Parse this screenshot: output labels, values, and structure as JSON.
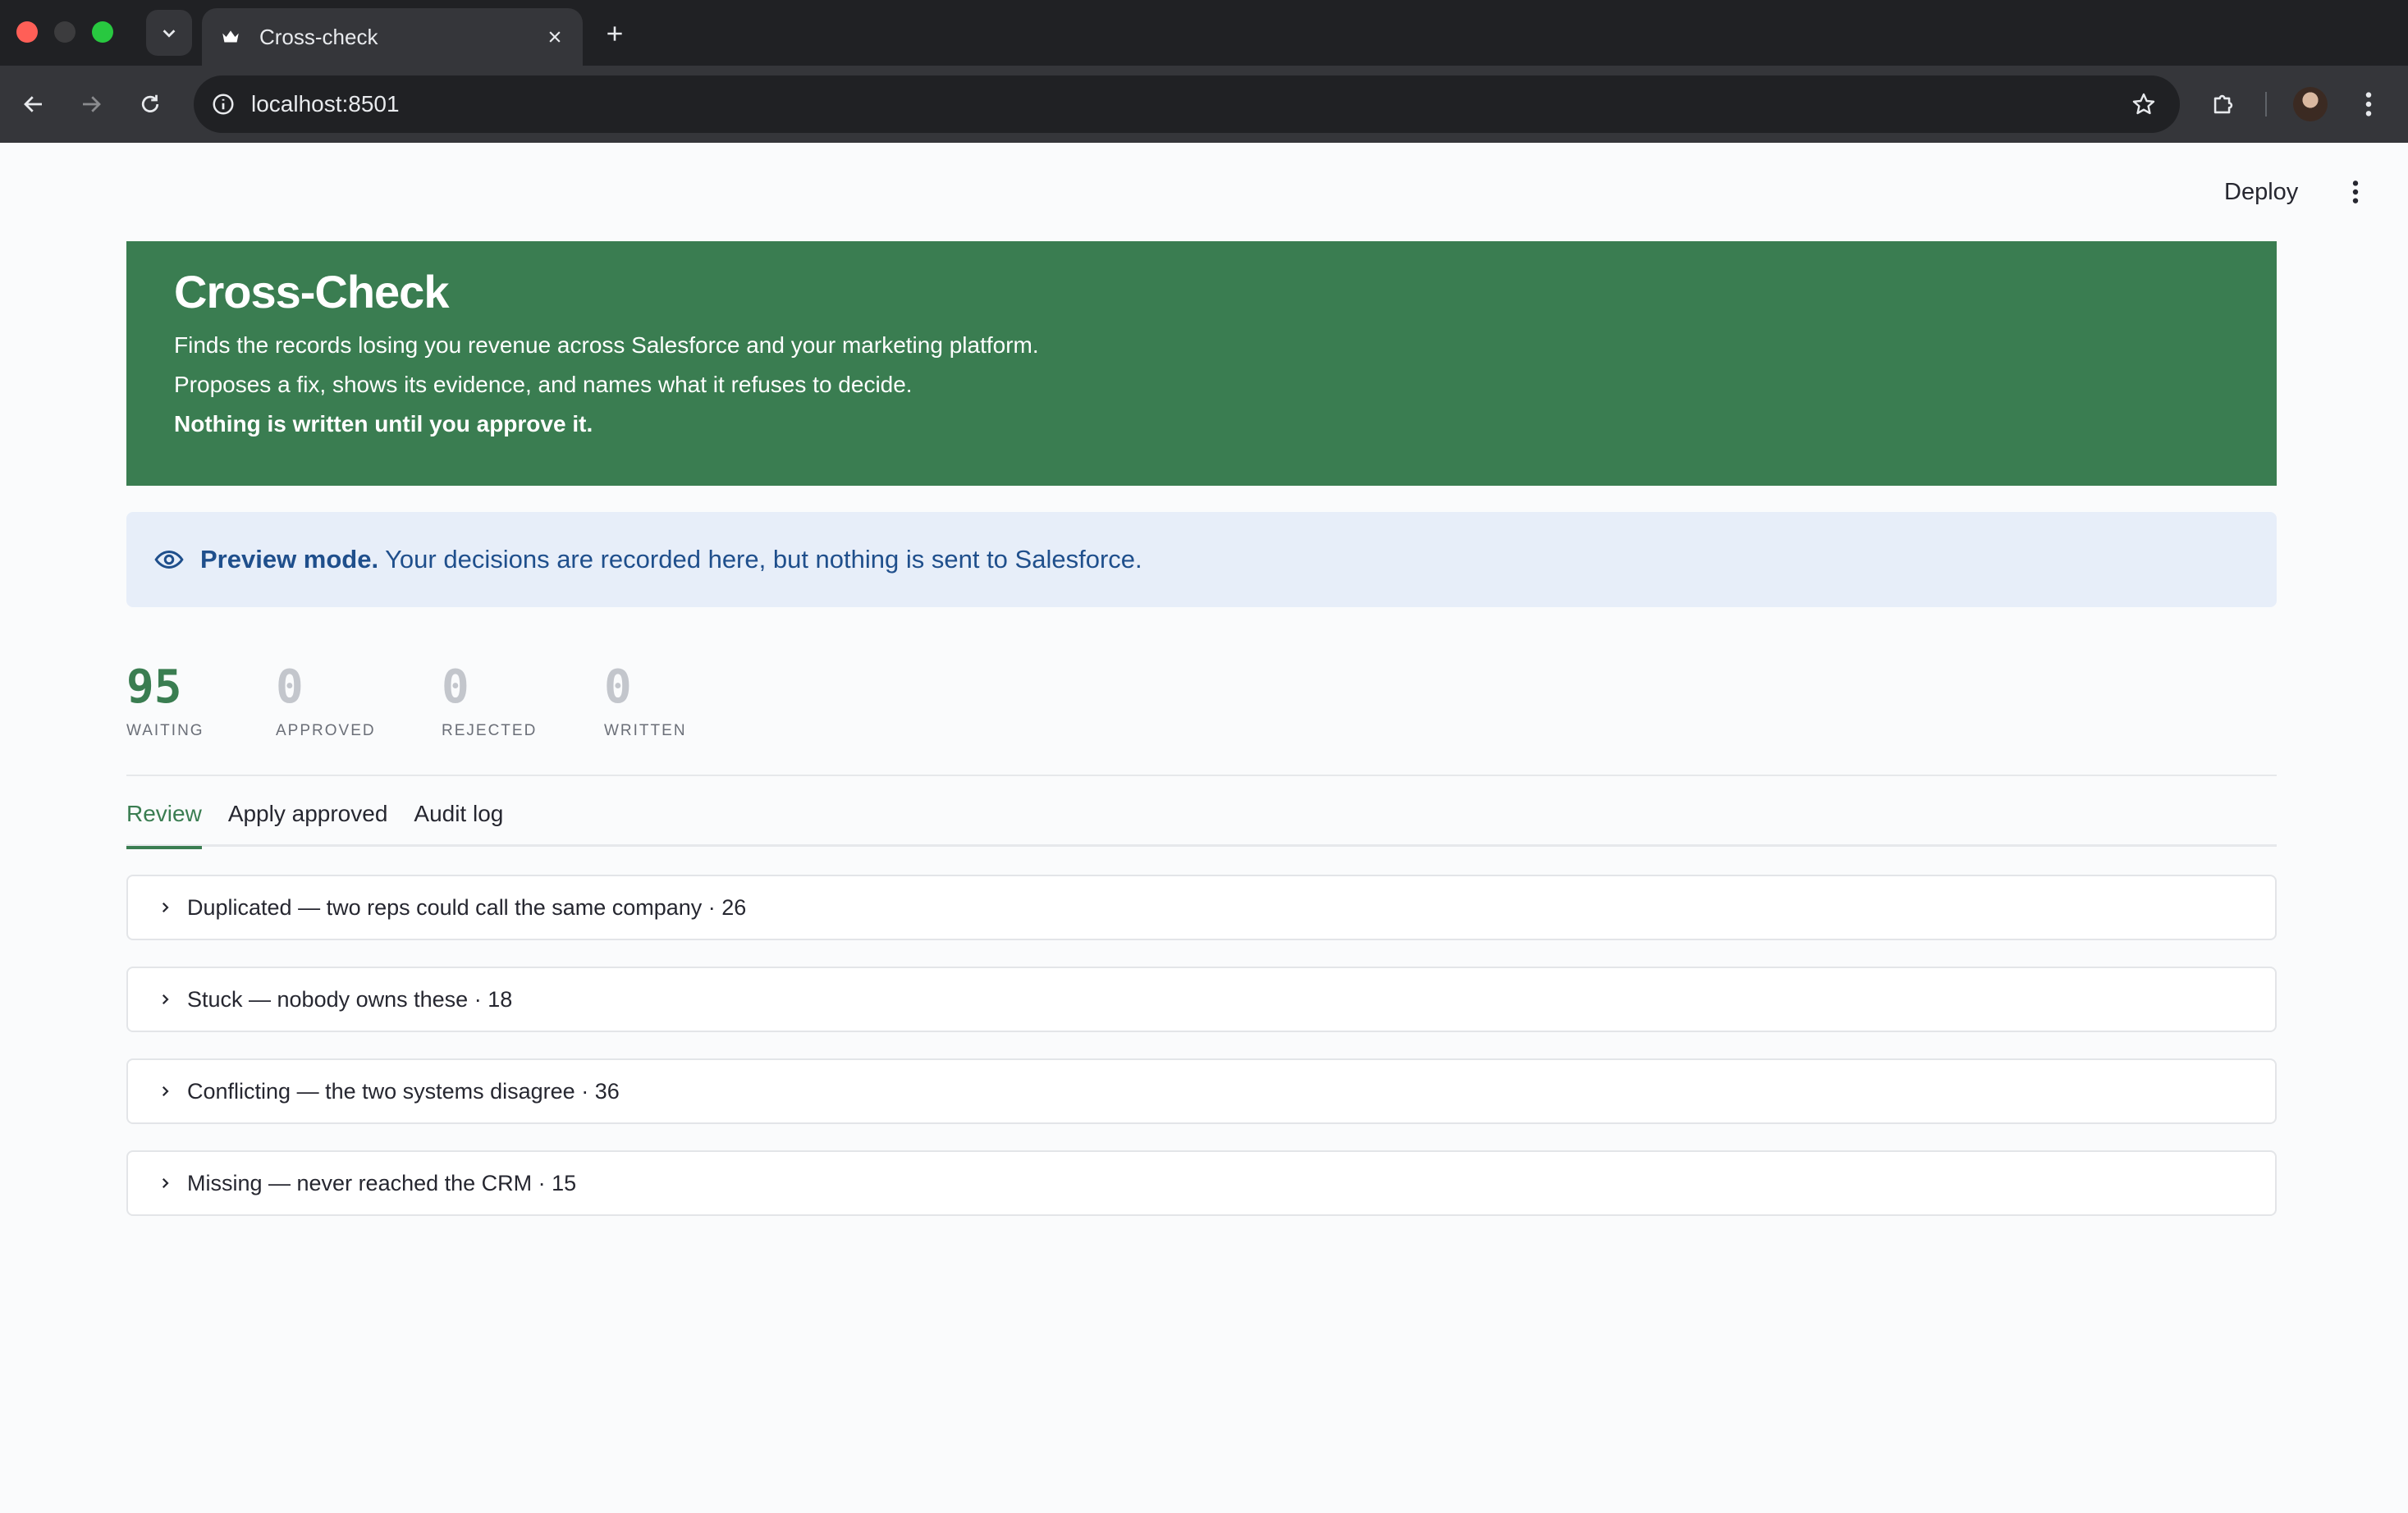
{
  "browser": {
    "tab_title": "Cross-check",
    "url": "localhost:8501"
  },
  "app": {
    "deploy_label": "Deploy",
    "title": "Cross-Check",
    "lines": [
      "Finds the records losing you revenue across Salesforce and your marketing platform.",
      "Proposes a fix, shows its evidence, and names what it refuses to decide.",
      "Nothing is written until you approve it."
    ],
    "brand_color": "#3a7d51"
  },
  "notice": {
    "strong": "Preview mode.",
    "text": "Your decisions are recorded here, but nothing is sent to Salesforce."
  },
  "metrics": [
    {
      "value": "95",
      "label": "WAITING"
    },
    {
      "value": "0",
      "label": "APPROVED"
    },
    {
      "value": "0",
      "label": "REJECTED"
    },
    {
      "value": "0",
      "label": "WRITTEN"
    }
  ],
  "tabs": [
    "Review",
    "Apply approved",
    "Audit log"
  ],
  "groups": [
    "Duplicated — two reps could call the same company · 26",
    "Stuck — nobody owns these · 18",
    "Conflicting — the two systems disagree · 36",
    "Missing — never reached the CRM · 15"
  ]
}
